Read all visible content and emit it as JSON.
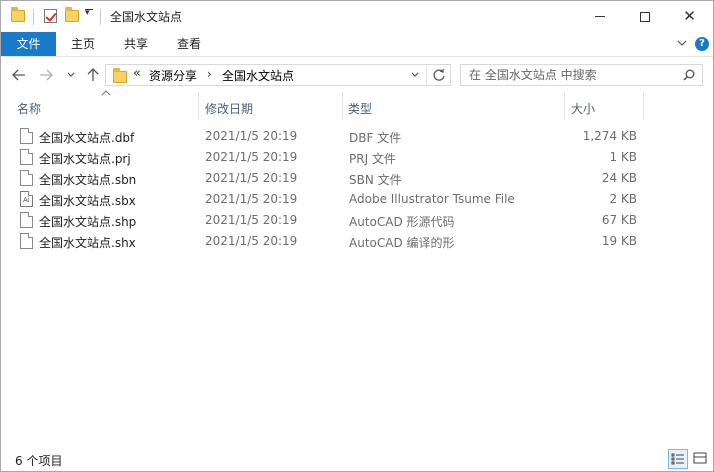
{
  "window": {
    "title": "全国水文站点"
  },
  "ribbon": {
    "tabs": [
      {
        "label": "文件"
      },
      {
        "label": "主页"
      },
      {
        "label": "共享"
      },
      {
        "label": "查看"
      }
    ],
    "help_label": "?"
  },
  "nav": {
    "breadcrumb": {
      "overflow": "«",
      "items": [
        "资源分享",
        "全国水文站点"
      ],
      "arrow": "›"
    },
    "search": {
      "placeholder": "在 全国水文站点 中搜索"
    }
  },
  "list": {
    "columns": {
      "name": "名称",
      "date": "修改日期",
      "type": "类型",
      "size": "大小"
    },
    "rows": [
      {
        "name": "全国水文站点.dbf",
        "date": "2021/1/5 20:19",
        "type": "DBF 文件",
        "size": "1,274 KB",
        "icon": "file-icon"
      },
      {
        "name": "全国水文站点.prj",
        "date": "2021/1/5 20:19",
        "type": "PRJ 文件",
        "size": "1 KB",
        "icon": "file-icon"
      },
      {
        "name": "全国水文站点.sbn",
        "date": "2021/1/5 20:19",
        "type": "SBN 文件",
        "size": "24 KB",
        "icon": "file-icon"
      },
      {
        "name": "全国水文站点.sbx",
        "date": "2021/1/5 20:19",
        "type": "Adobe Illustrator Tsume File",
        "size": "2 KB",
        "icon": "illustrator-file-icon"
      },
      {
        "name": "全国水文站点.shp",
        "date": "2021/1/5 20:19",
        "type": "AutoCAD 形源代码",
        "size": "67 KB",
        "icon": "file-icon"
      },
      {
        "name": "全国水文站点.shx",
        "date": "2021/1/5 20:19",
        "type": "AutoCAD 编译的形",
        "size": "19 KB",
        "icon": "file-icon"
      }
    ]
  },
  "status": {
    "item_count": "6 个项目"
  },
  "colors": {
    "accent": "#1979ca",
    "header_text": "#4c607a"
  }
}
